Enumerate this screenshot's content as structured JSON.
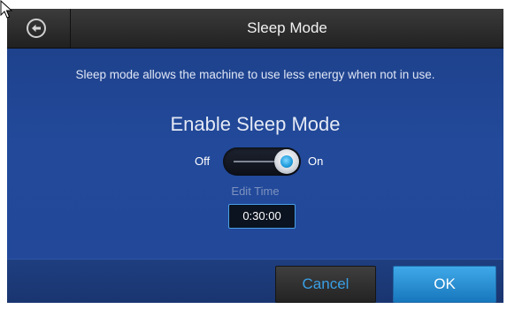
{
  "header": {
    "title": "Sleep Mode",
    "back_icon": "back-arrow-circle-icon"
  },
  "main": {
    "description": "Sleep mode allows the machine to use less energy when not in use.",
    "heading": "Enable Sleep Mode",
    "toggle": {
      "off_label": "Off",
      "on_label": "On",
      "state": "on"
    },
    "edit_time_label": "Edit Time",
    "time_value": "0:30:00"
  },
  "footer": {
    "cancel_label": "Cancel",
    "ok_label": "OK"
  },
  "colors": {
    "background": "#22499a",
    "accent": "#2b8fd6",
    "titlebar": "#2a2a2a"
  }
}
